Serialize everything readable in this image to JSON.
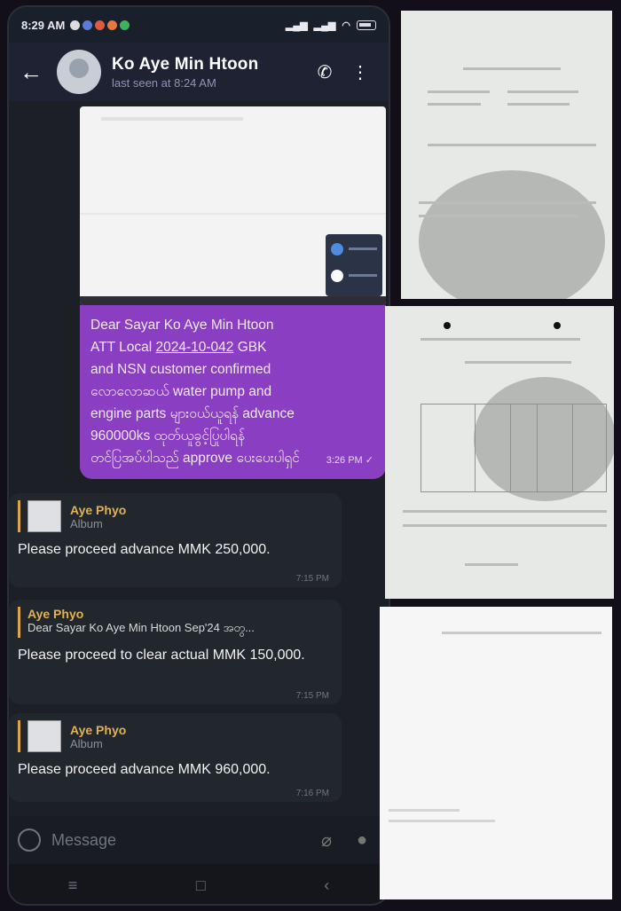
{
  "status_bar": {
    "time": "8:29 AM"
  },
  "header": {
    "contact_name": "Ko Aye Min Htoon",
    "last_seen": "last seen at 8:24 AM"
  },
  "messages": {
    "purple": {
      "line1": "Dear Sayar Ko Aye Min Htoon",
      "line2_pre": "ATT Local ",
      "line2_link": "2024-10-042",
      "line2_post": " GBK",
      "line3": "and NSN customer confirmed",
      "line4": "လောလောဆယ် water pump and",
      "line5": "engine parts များဝယ်ယူရန် advance",
      "line6": "960000ks ထုတ်ယူခွင့်ပြုပါရန်",
      "line7": "တင်ပြအပ်ပါသည် approve ပေးပေးပါရှင်",
      "time": "3:26 PM"
    },
    "reply1": {
      "quote_name": "Aye Phyo",
      "quote_sub": "Album",
      "text": "Please proceed advance MMK 250,000.",
      "time": "7:15 PM"
    },
    "reply2": {
      "quote_name": "Aye Phyo",
      "quote_sub": "Dear Sayar Ko Aye Min Htoon Sep'24 အတွ...",
      "text": "Please proceed to clear actual MMK 150,000.",
      "time": "7:15 PM"
    },
    "reply3": {
      "quote_name": "Aye Phyo",
      "quote_sub": "Album",
      "text": "Please proceed advance MMK 960,000.",
      "time": "7:16 PM"
    }
  },
  "input": {
    "placeholder": "Message"
  },
  "colors": {
    "purple_bubble": "#8a3fc2",
    "quote_accent": "#e2b251",
    "header": "#1e2233"
  }
}
